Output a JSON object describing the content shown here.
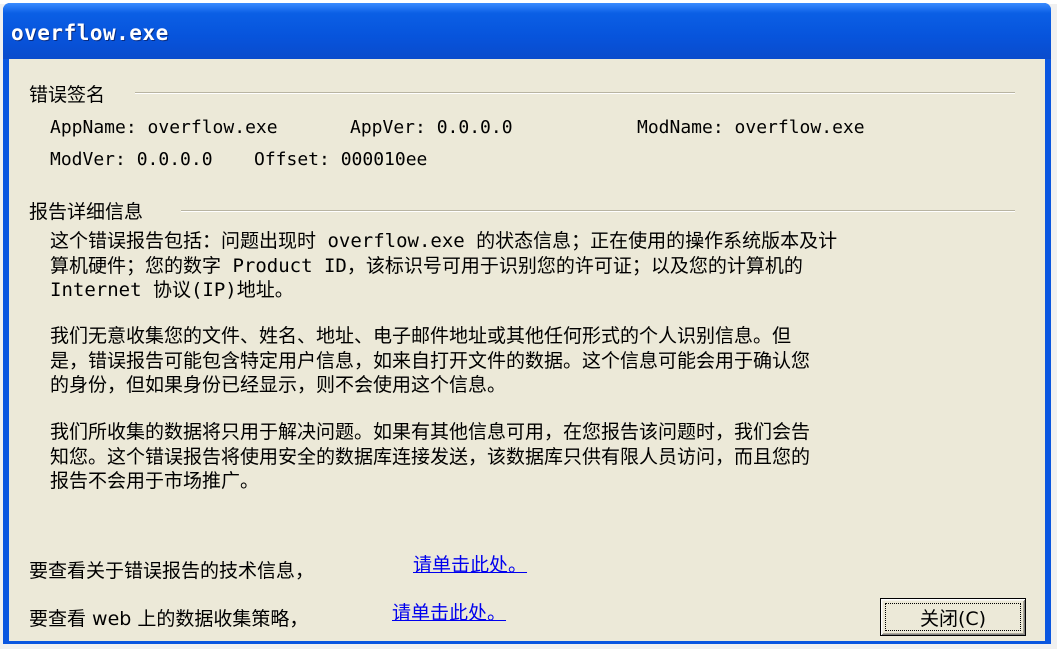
{
  "window": {
    "title": "overflow.exe"
  },
  "signature": {
    "heading": "错误签名",
    "app_name": "AppName: overflow.exe",
    "app_ver": "AppVer: 0.0.0.0",
    "mod_name": "ModName: overflow.exe",
    "mod_ver": "ModVer: 0.0.0.0",
    "offset": "Offset: 000010ee"
  },
  "details": {
    "heading": "报告详细信息",
    "para1": [
      "这个错误报告包括：问题出现时 overflow.exe 的状态信息；正在使用的操作系统版本及计",
      "算机硬件；您的数字 Product ID，该标识号可用于识别您的许可证；以及您的计算机的",
      "Internet 协议(IP)地址。"
    ],
    "para2": [
      "我们无意收集您的文件、姓名、地址、电子邮件地址或其他任何形式的个人识别信息。但",
      "是，错误报告可能包含特定用户信息，如来自打开文件的数据。这个信息可能会用于确认您",
      "的身份，但如果身份已经显示，则不会使用这个信息。"
    ],
    "para3": [
      "我们所收集的数据将只用于解决问题。如果有其他信息可用，在您报告该问题时，我们会告",
      "知您。这个错误报告将使用安全的数据库连接发送，该数据库只供有限人员访问，而且您的",
      "报告不会用于市场推广。"
    ]
  },
  "footer": {
    "tech_info_text": "要查看关于错误报告的技术信息，",
    "tech_info_link": "请单击此处。",
    "policy_text": "要查看 web 上的数据收集策略，",
    "policy_link": "请单击此处。",
    "close_label": "关闭(C)"
  }
}
